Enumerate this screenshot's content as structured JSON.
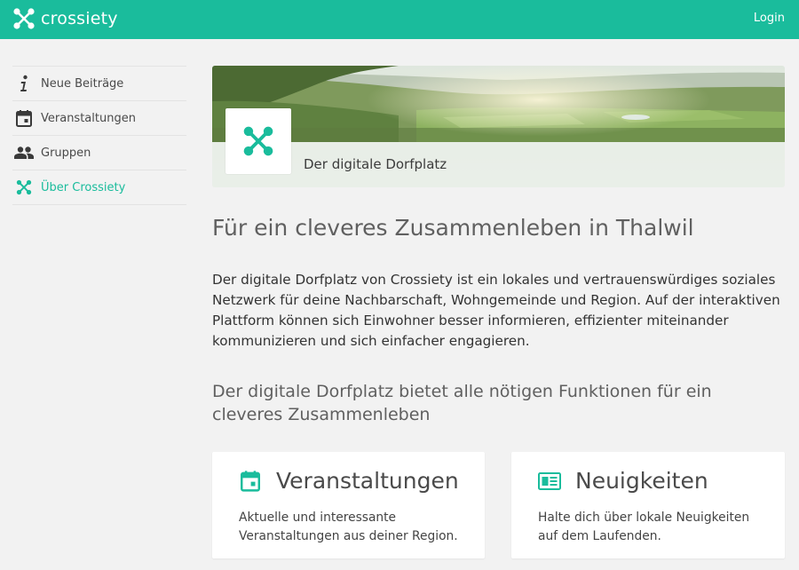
{
  "header": {
    "brand": "crossiety",
    "login_label": "Login"
  },
  "sidebar": {
    "items": [
      {
        "label": "Neue Beiträge",
        "icon": "info-icon"
      },
      {
        "label": "Veranstaltungen",
        "icon": "calendar-icon"
      },
      {
        "label": "Gruppen",
        "icon": "people-icon"
      },
      {
        "label": "Über Crossiety",
        "icon": "crossiety-logo-icon",
        "active": true
      }
    ]
  },
  "hero": {
    "tagline": "Der digitale Dorfplatz"
  },
  "main": {
    "heading": "Für ein cleveres Zusammenleben in Thalwil",
    "intro": "Der digitale Dorfplatz von Crossiety ist ein lokales und vertrauenswürdiges soziales Netzwerk für deine Nachbarschaft, Wohngemeinde und Region. Auf der interaktiven Plattform können sich Einwohner besser informieren, effizienter miteinander kommunizieren und sich einfacher engagieren.",
    "subheading": "Der digitale Dorfplatz bietet alle nötigen Funktionen für ein cleveres Zusammenleben"
  },
  "features": [
    {
      "title": "Veranstaltungen",
      "text": "Aktuelle und interessante Veranstaltungen aus deiner Region.",
      "icon": "calendar-icon"
    },
    {
      "title": "Neuigkeiten",
      "text": "Halte dich über lokale Neuigkeiten auf dem Laufenden.",
      "icon": "newspaper-icon"
    }
  ],
  "colors": {
    "brand": "#1abc9c",
    "background": "#f2f2f2",
    "text": "#4a4a4a"
  }
}
